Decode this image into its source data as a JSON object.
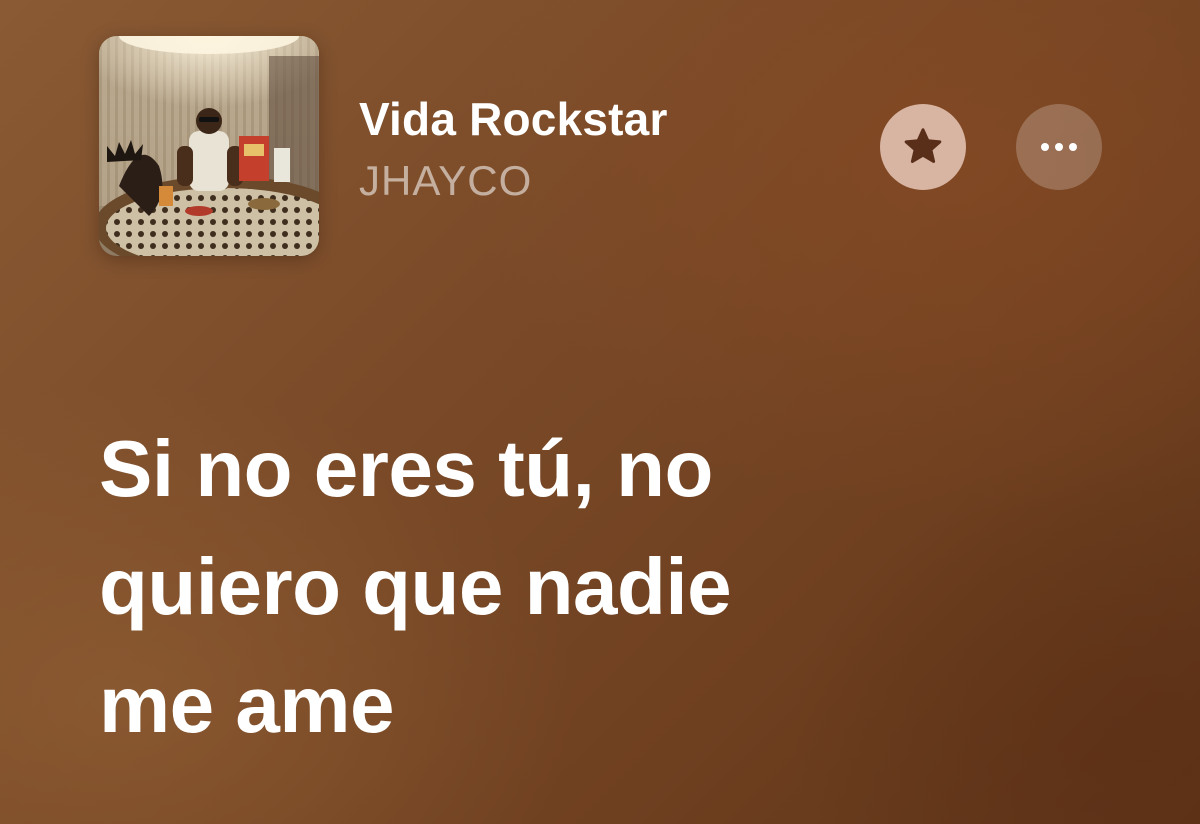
{
  "now_playing": {
    "title": "Vida Rockstar",
    "artist": "JHAYCO",
    "artwork_icon": "album-artwork",
    "favorite_icon": "star-icon",
    "more_icon": "ellipsis-icon"
  },
  "lyrics": {
    "current_lines": [
      "Si no eres tú, no",
      "quiero que nadie",
      "me ame"
    ]
  },
  "colors": {
    "background_primary": "#7a4a28",
    "favorite_button": "#d8b4a2",
    "star_icon": "#5a2f1a",
    "text_primary": "#ffffff"
  }
}
